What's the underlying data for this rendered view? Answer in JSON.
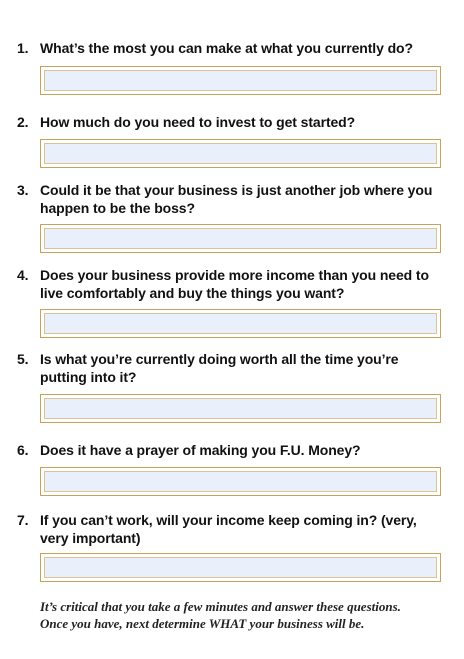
{
  "questions": [
    {
      "number": "1.",
      "text": "What’s the most you can make at what you currently do?"
    },
    {
      "number": "2.",
      "text": "How much do you need to invest to get started?"
    },
    {
      "number": "3.",
      "text": "Could it be that your business is just another job where you happen to be the boss?"
    },
    {
      "number": "4.",
      "text": "Does your business provide more income than you need to live comfortably and buy the things you want?"
    },
    {
      "number": "5.",
      "text": "Is what you’re currently doing worth all the time you’re putting into it?"
    },
    {
      "number": "6.",
      "text": "Does it have a prayer of making you F.U. Money?"
    },
    {
      "number": "7.",
      "text": "If you can’t work, will your income keep coming in? (very, very important)"
    }
  ],
  "answers": [
    "",
    "",
    "",
    "",
    "",
    "",
    ""
  ],
  "footer": {
    "line1": "It’s critical that you take a few minutes and answer these questions.",
    "line2": "Once you have, next determine WHAT your business will be."
  },
  "colors": {
    "field_border": "#c9a25a",
    "field_fill": "#eaf0fb"
  }
}
